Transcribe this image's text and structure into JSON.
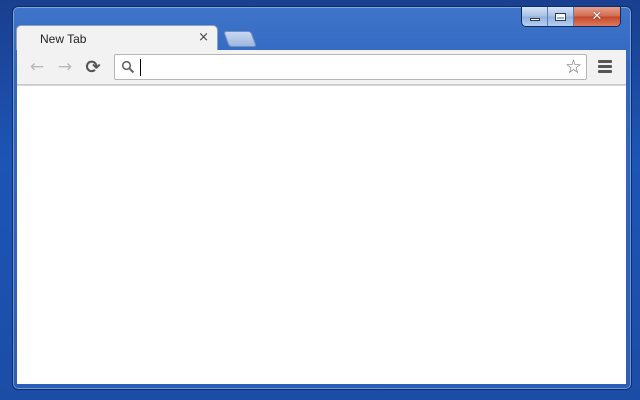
{
  "window": {
    "caption": {
      "minimize_icon": "minimize-icon",
      "maximize_icon": "maximize-icon",
      "close_label": "✕"
    }
  },
  "tabs": [
    {
      "title": "New Tab",
      "close_label": "×"
    }
  ],
  "toolbar": {
    "back_label": "←",
    "forward_label": "→",
    "reload_label": "⟳",
    "star_label": "☆",
    "omnibox": {
      "value": "",
      "placeholder": ""
    }
  },
  "colors": {
    "desktop": "#1d55b5",
    "frame": "#2f66c0",
    "tab": "#f2f2f2",
    "close_button": "#c4462a"
  }
}
